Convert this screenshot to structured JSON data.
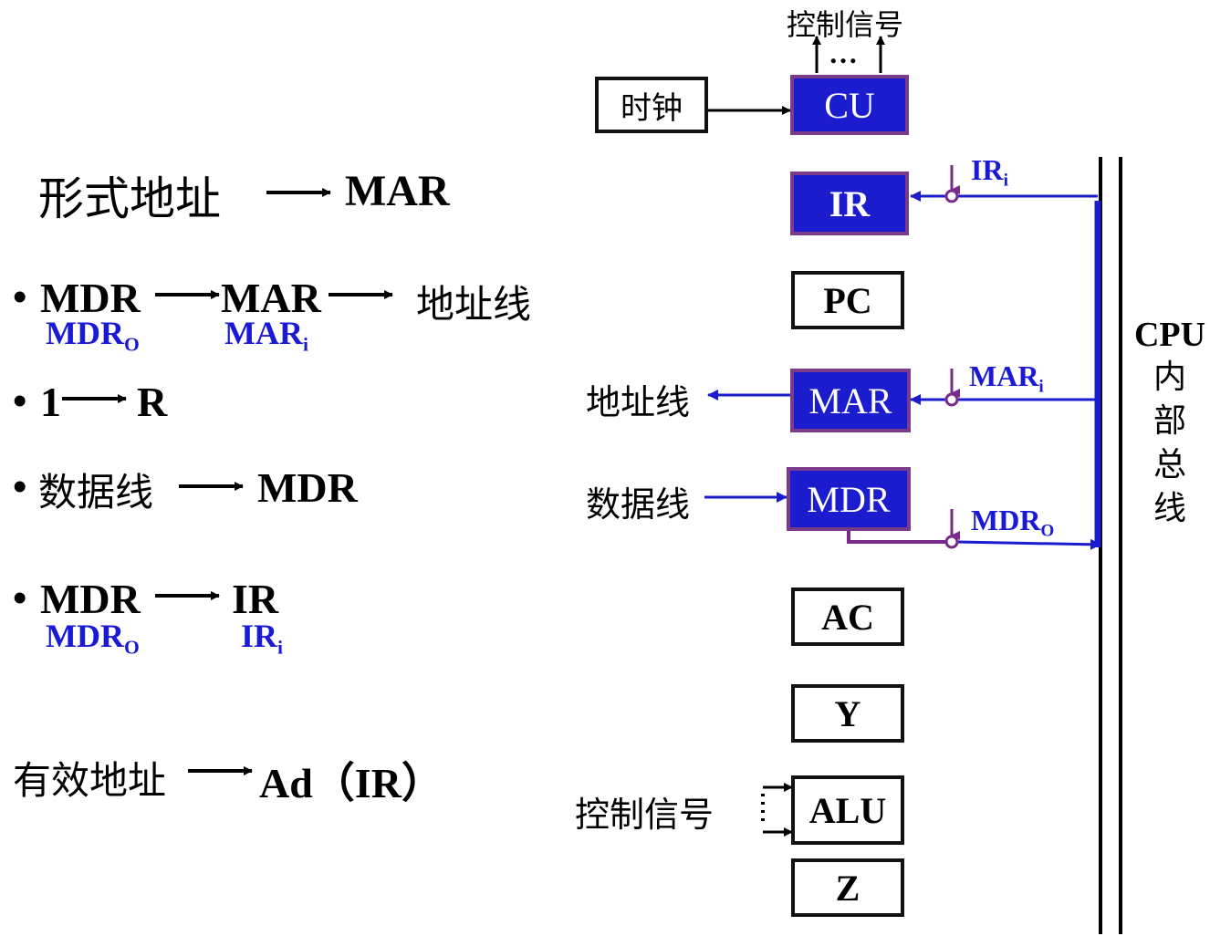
{
  "left": {
    "line1": {
      "lhs": "形式地址",
      "rhs": "MAR"
    },
    "line2": {
      "bullet": "•",
      "a": "MDR",
      "b": "MAR",
      "c": "地址线",
      "sig_a": "MDR",
      "sig_a_sub": "O",
      "sig_b": "MAR",
      "sig_b_sub": "i"
    },
    "line3": {
      "bullet": "•",
      "a": "1",
      "b": "R"
    },
    "line4": {
      "bullet": "•",
      "a": "数据线",
      "b": "MDR"
    },
    "line5": {
      "bullet": "•",
      "a": "MDR",
      "b": "IR",
      "sig_a": "MDR",
      "sig_a_sub": "O",
      "sig_b": "IR",
      "sig_b_sub": "i"
    },
    "line6": {
      "lhs": "有效地址",
      "rhs": "Ad（IR）"
    }
  },
  "diagram": {
    "top_control": "控制信号",
    "dots": "…",
    "clock": "时钟",
    "cu": "CU",
    "ir": "IR",
    "pc": "PC",
    "mar": "MAR",
    "mdr": "MDR",
    "ac": "AC",
    "y": "Y",
    "alu": "ALU",
    "z": "Z",
    "addr_line": "地址线",
    "data_line": "数据线",
    "alu_control": "控制信号",
    "sig_ir": "IR",
    "sig_ir_sub": "i",
    "sig_mar": "MAR",
    "sig_mar_sub": "i",
    "sig_mdr": "MDR",
    "sig_mdr_sub": "O",
    "bus_label": [
      "CPU",
      "内",
      "部",
      "总",
      "线"
    ]
  },
  "colors": {
    "blue": "#1c1ccf",
    "purple": "#7a2a8a",
    "signal_text": "#1a1ad6"
  }
}
